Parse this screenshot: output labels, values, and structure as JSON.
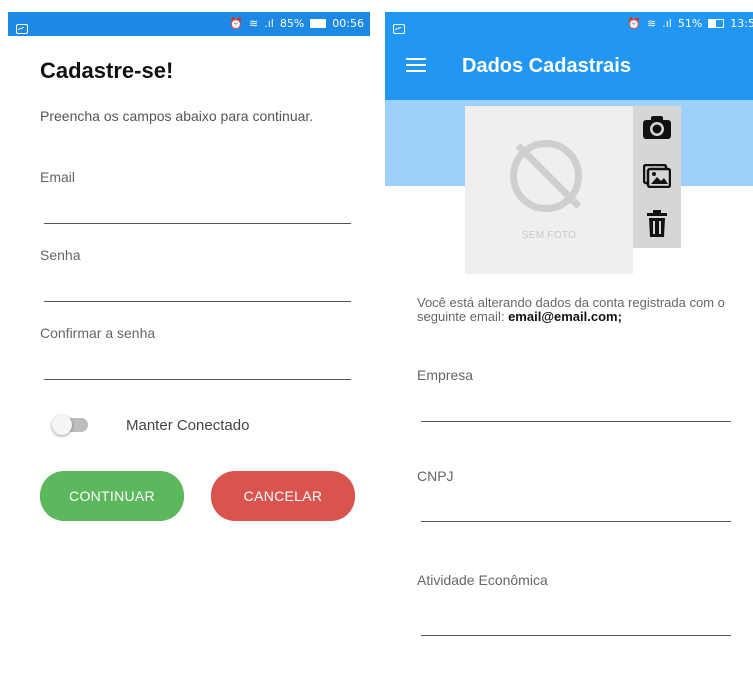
{
  "left_screen": {
    "status_bar": {
      "battery": "85%",
      "time": "00:56"
    },
    "title": "Cadastre-se!",
    "subtitle": "Preencha os campos abaixo para continuar.",
    "fields": [
      {
        "label": "Email"
      },
      {
        "label": "Senha"
      },
      {
        "label": "Confirmar a senha"
      }
    ],
    "toggle": {
      "label": "Manter Conectado",
      "on": false
    },
    "buttons": {
      "continue": "CONTINUAR",
      "cancel": "CANCELAR"
    }
  },
  "right_screen": {
    "status_bar": {
      "battery": "51%",
      "time": "13:5"
    },
    "app_bar": {
      "title": "Dados Cadastrais"
    },
    "photo": {
      "placeholder": "SEM FOTO"
    },
    "photo_actions": [
      "camera-icon",
      "gallery-icon",
      "trash-icon"
    ],
    "info": {
      "prefix": "Você está alterando dados da conta registrada com o seguinte email:",
      "email": "email@email.com;"
    },
    "fields": [
      {
        "label": "Empresa"
      },
      {
        "label": "CNPJ"
      },
      {
        "label": "Atividade Econômica"
      }
    ]
  },
  "colors": {
    "primary": "#2196f3",
    "banner": "#9dd1fb",
    "continue": "#5cb85c",
    "cancel": "#d9534f"
  }
}
